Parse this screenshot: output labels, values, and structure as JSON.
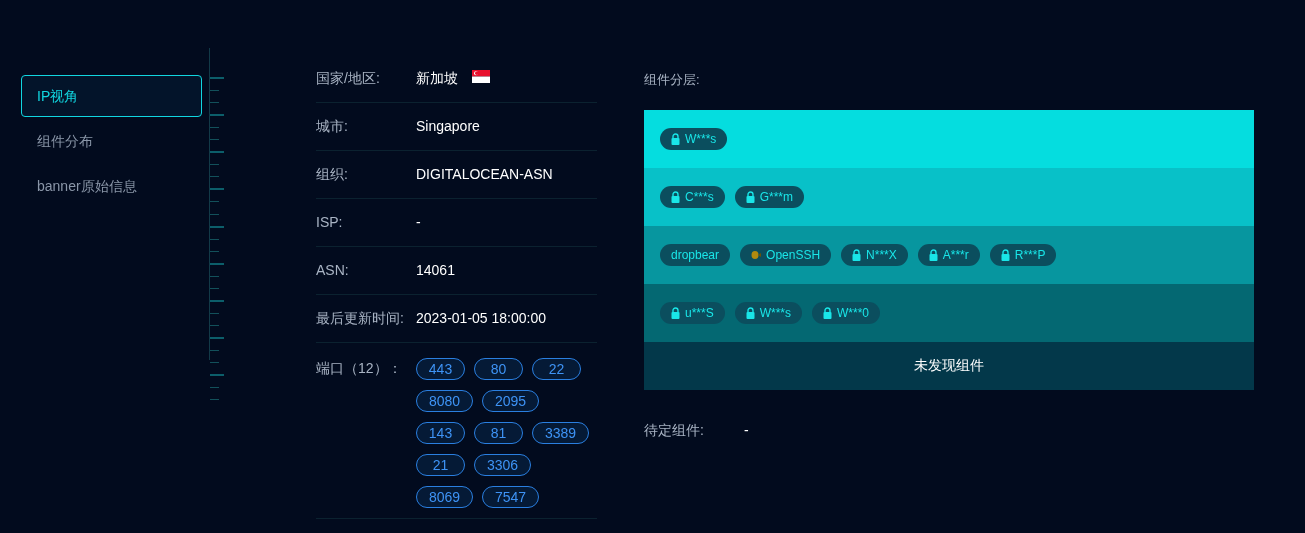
{
  "sidebar": {
    "items": [
      {
        "label": "IP视角",
        "selected": true
      },
      {
        "label": "组件分布",
        "selected": false
      },
      {
        "label": "banner原始信息",
        "selected": false
      }
    ]
  },
  "info": {
    "rows": [
      {
        "label": "国家/地区:",
        "value": "新加坡",
        "flag": true
      },
      {
        "label": "城市:",
        "value": "Singapore",
        "flag": false
      },
      {
        "label": "组织:",
        "value": "DIGITALOCEAN-ASN",
        "flag": false
      },
      {
        "label": "ISP:",
        "value": "-",
        "flag": false
      },
      {
        "label": "ASN:",
        "value": "14061",
        "flag": false
      },
      {
        "label": "最后更新时间:",
        "value": "2023-01-05 18:00:00",
        "flag": false
      }
    ],
    "ports_label": "端口（12）：",
    "ports": [
      "443",
      "80",
      "22",
      "8080",
      "2095",
      "143",
      "81",
      "3389",
      "21",
      "3306",
      "8069",
      "7547"
    ]
  },
  "layers": {
    "title": "组件分层:",
    "rows": [
      {
        "color": "#05dddf",
        "chips": [
          {
            "kind": "locked",
            "label": "W***s"
          }
        ]
      },
      {
        "color": "#08c1c8",
        "chips": [
          {
            "kind": "locked",
            "label": "C***s"
          },
          {
            "kind": "locked",
            "label": "G***m"
          }
        ]
      },
      {
        "color": "#07969f",
        "chips": [
          {
            "kind": "plain",
            "label": "dropbear"
          },
          {
            "kind": "logo",
            "label": "OpenSSH"
          },
          {
            "kind": "locked",
            "label": "N***X"
          },
          {
            "kind": "locked",
            "label": "A***r"
          },
          {
            "kind": "locked",
            "label": "R***P"
          }
        ]
      },
      {
        "color": "#046872",
        "chips": [
          {
            "kind": "locked",
            "label": "u***S"
          },
          {
            "kind": "locked",
            "label": "W***s"
          },
          {
            "kind": "locked",
            "label": "W***0"
          }
        ]
      }
    ],
    "empty": "未发现组件"
  },
  "pending": {
    "label": "待定组件:",
    "value": "-"
  }
}
